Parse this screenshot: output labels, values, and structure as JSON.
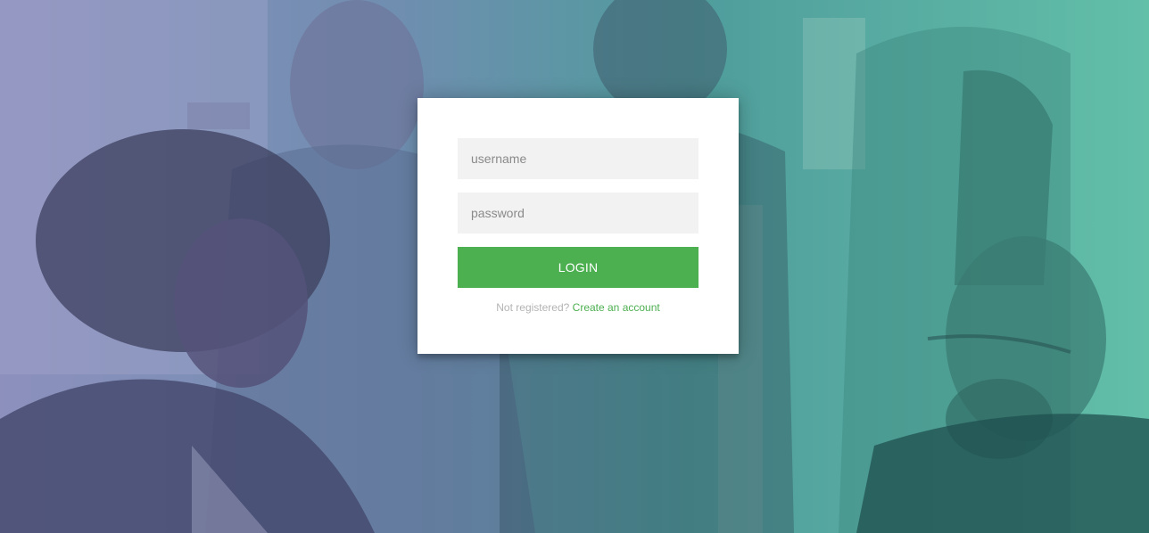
{
  "login": {
    "username_placeholder": "username",
    "password_placeholder": "password",
    "login_label": "LOGIN",
    "register_prompt": "Not registered?",
    "create_account_link": "Create an account"
  },
  "colors": {
    "accent": "#4caf50",
    "field_background": "#f2f2f2",
    "card_background": "#ffffff",
    "gradient_left": "#8d90bd",
    "gradient_right": "#62bfa8"
  }
}
